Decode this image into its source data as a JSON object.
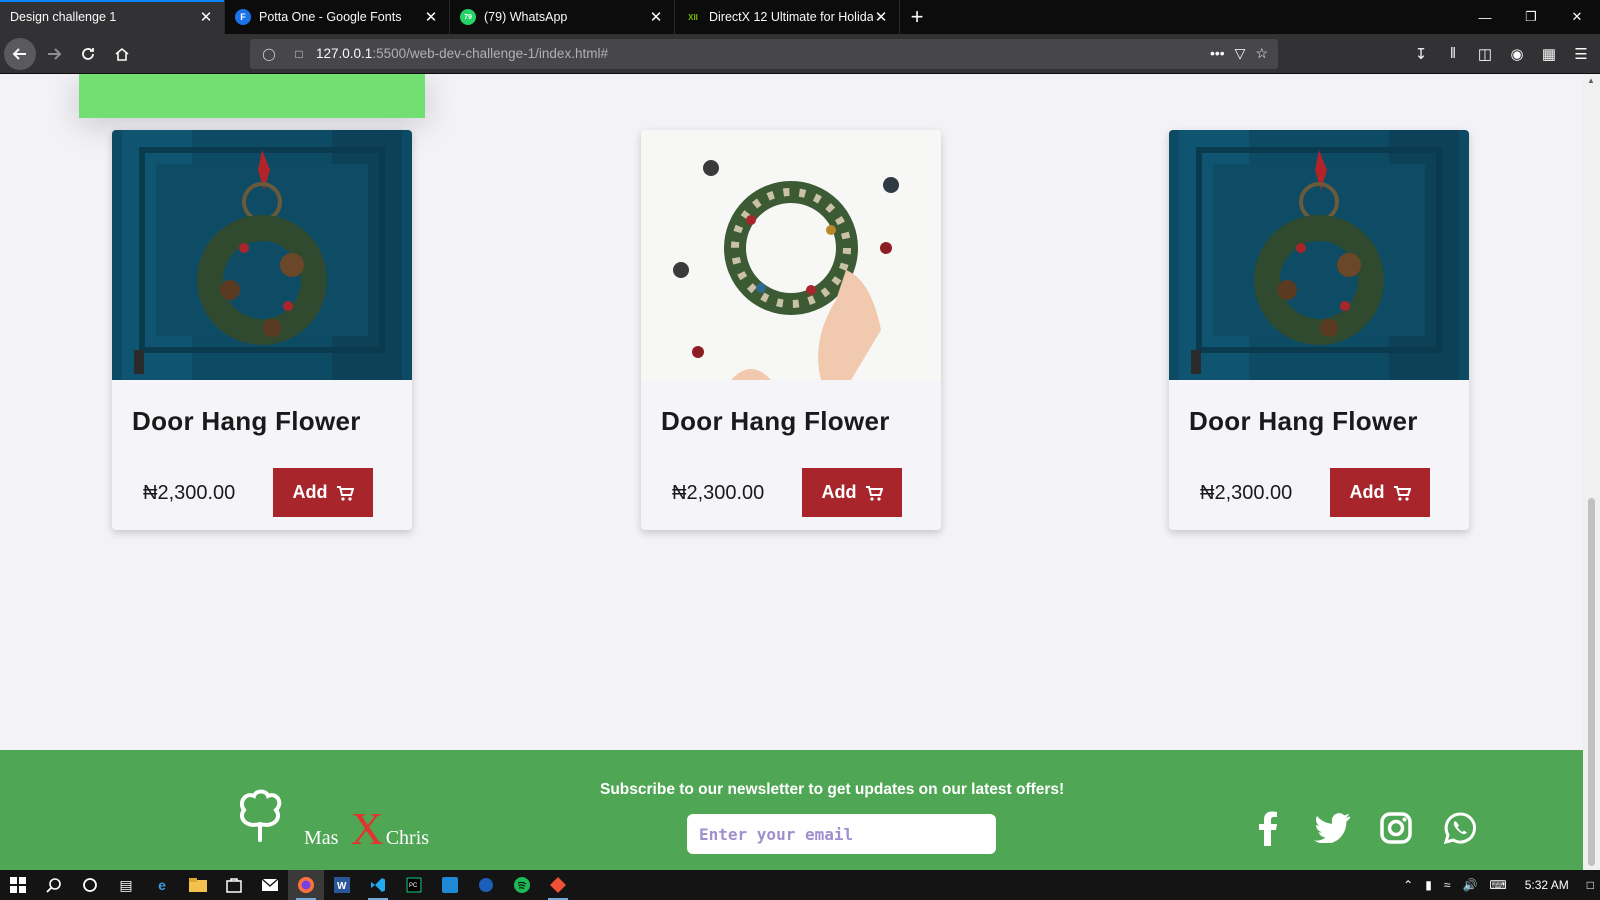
{
  "browser": {
    "tabs": [
      {
        "title": "Design challenge 1",
        "active": true,
        "favicon": "none"
      },
      {
        "title": "Potta One - Google Fonts",
        "active": false,
        "favicon": "F"
      },
      {
        "title": "(79) WhatsApp",
        "active": false,
        "favicon": "79"
      },
      {
        "title": "DirectX 12 Ultimate for Holiday",
        "active": false,
        "favicon": "XII"
      }
    ],
    "url_host": "127.0.0.1",
    "url_path": ":5500/web-dev-challenge-1/index.html#"
  },
  "products": [
    {
      "title": "Door Hang Flower",
      "price": "₦2,300.00",
      "button": "Add",
      "image": "door-wreath"
    },
    {
      "title": "Door Hang Flower",
      "price": "₦2,300.00",
      "button": "Add",
      "image": "white-wreath"
    },
    {
      "title": "Door Hang Flower",
      "price": "₦2,300.00",
      "button": "Add",
      "image": "door-wreath"
    }
  ],
  "footer": {
    "logo_left": "Mas",
    "logo_x": "X",
    "logo_right": "Chris",
    "newsletter_title": "Subscribe to our newsletter to get updates on our latest offers!",
    "email_placeholder": "Enter your email",
    "socials": [
      "facebook-icon",
      "twitter-icon",
      "instagram-icon",
      "whatsapp-icon"
    ]
  },
  "taskbar": {
    "clock": "5:32 AM"
  },
  "colors": {
    "accent_green": "#72df73",
    "footer_green": "#4fa654",
    "add_button": "#a8262b",
    "logo_x": "#e0342e"
  }
}
